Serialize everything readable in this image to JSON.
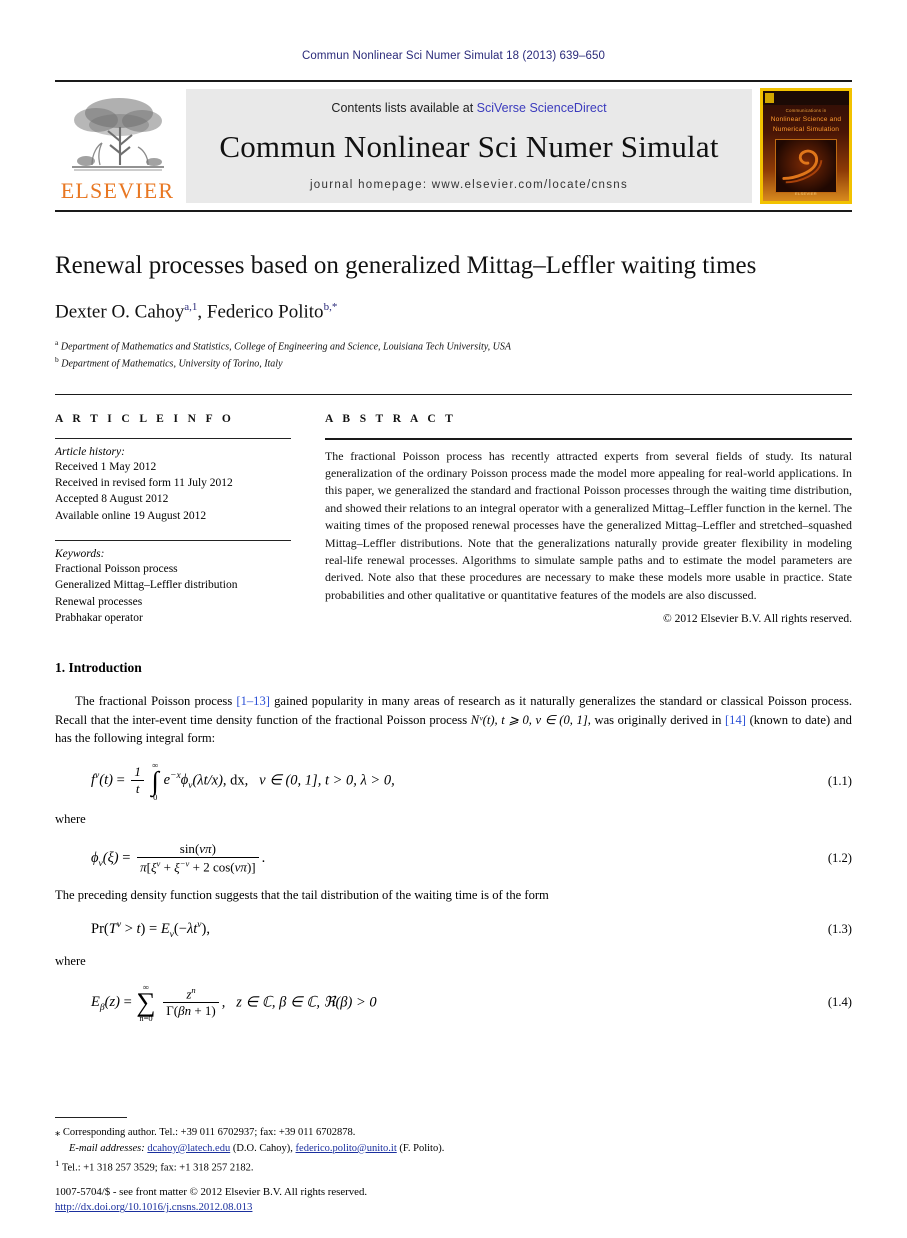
{
  "running_head": "Commun Nonlinear Sci Numer Simulat 18 (2013) 639–650",
  "masthead": {
    "contents_prefix": "Contents lists available at ",
    "sciencedirect_link": "SciVerse ScienceDirect",
    "journal_title": "Commun Nonlinear Sci Numer Simulat",
    "homepage": "journal homepage: www.elsevier.com/locate/cnsns",
    "publisher_logo_text": "ELSEVIER",
    "cover": {
      "line_small": "Communications in",
      "line_big": "Nonlinear Science and Numerical Simulation",
      "footer": "ELSEVIER"
    }
  },
  "article": {
    "title": "Renewal processes based on generalized Mittag–Leffler waiting times",
    "authors": [
      {
        "name": "Dexter O. Cahoy",
        "marks": "a,1"
      },
      {
        "name": "Federico Polito",
        "marks": "b,*"
      }
    ],
    "affiliations": [
      {
        "mark": "a",
        "text": "Department of Mathematics and Statistics, College of Engineering and Science, Louisiana Tech University, USA"
      },
      {
        "mark": "b",
        "text": "Department of Mathematics, University of Torino, Italy"
      }
    ]
  },
  "info": {
    "label": "A R T I C L E    I N F O",
    "history_head": "Article history:",
    "history": [
      "Received 1 May 2012",
      "Received in revised form 11 July 2012",
      "Accepted 8 August 2012",
      "Available online 19 August 2012"
    ],
    "keywords_head": "Keywords:",
    "keywords": [
      "Fractional Poisson process",
      "Generalized Mittag–Leffler distribution",
      "Renewal processes",
      "Prabhakar operator"
    ]
  },
  "abstract": {
    "label": "A B S T R A C T",
    "text": "The fractional Poisson process has recently attracted experts from several fields of study. Its natural generalization of the ordinary Poisson process made the model more appealing for real-world applications. In this paper, we generalized the standard and fractional Poisson processes through the waiting time distribution, and showed their relations to an integral operator with a generalized Mittag–Leffler function in the kernel. The waiting times of the proposed renewal processes have the generalized Mittag–Leffler and stretched–squashed Mittag–Leffler distributions. Note that the generalizations naturally provide greater flexibility in modeling real-life renewal processes. Algorithms to simulate sample paths and to estimate the model parameters are derived. Note also that these procedures are necessary to make these models more usable in practice. State probabilities and other qualitative or quantitative features of the models are also discussed.",
    "copyright": "© 2012 Elsevier B.V. All rights reserved."
  },
  "section": {
    "number_title": "1. Introduction",
    "para_1_a": "The fractional Poisson process ",
    "para_1_cite1": "[1–13]",
    "para_1_b": " gained popularity in many areas of research as it naturally generalizes the standard or classical Poisson process. Recall that the inter-event time density function of the fractional Poisson process ",
    "para_1_math": "Nᵛ(t), t ⩾ 0, ν ∈ (0, 1]",
    "para_1_c": ", was originally derived in ",
    "para_1_cite2": "[14]",
    "para_1_d": " (known to date) and has the following integral form:",
    "where_1": "where",
    "after_eq2": "The preceding density function suggests that the tail distribution of the waiting time is of the form",
    "where_2": "where"
  },
  "equations": {
    "eq1": {
      "number": "(1.1)",
      "condition": "ν ∈ (0, 1], t > 0, λ > 0,"
    },
    "eq2": {
      "number": "(1.2)"
    },
    "eq3": {
      "number": "(1.3)"
    },
    "eq4": {
      "number": "(1.4)",
      "condition": "z ∈ ℂ, β ∈ ℂ, ℜ(β) > 0"
    }
  },
  "footnotes": {
    "corresponding": "Corresponding author. Tel.: +39 011 6702937; fax: +39 011 6702878.",
    "email_label": "E-mail addresses:",
    "email_1": "dcahoy@latech.edu",
    "email_1_who": "(D.O. Cahoy),",
    "email_2": "federico.polito@unito.it",
    "email_2_who": "(F. Polito).",
    "note_1_mark": "1",
    "note_1": "Tel.: +1 318 257 3529; fax: +1 318 257 2182."
  },
  "colophon": {
    "line1": "1007-5704/$ - see front matter © 2012 Elsevier B.V. All rights reserved.",
    "doi": "http://dx.doi.org/10.1016/j.cnsns.2012.08.013"
  }
}
